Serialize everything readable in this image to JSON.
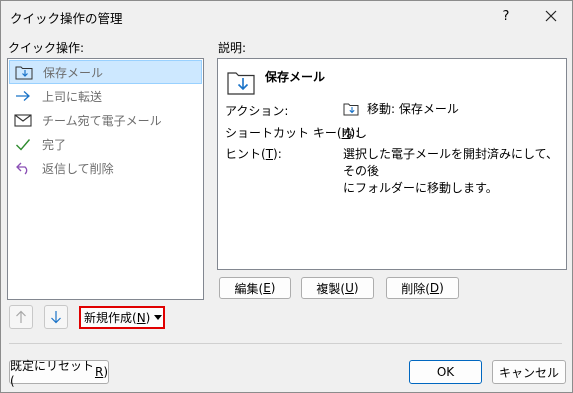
{
  "window": {
    "title": "クイック操作の管理",
    "help_glyph": "?"
  },
  "labels": {
    "quick_steps": "クイック操作:",
    "description": "説明:"
  },
  "quick_steps": [
    {
      "label": "保存メール",
      "icon": "folder-arrow-icon",
      "selected": true
    },
    {
      "label": "上司に転送",
      "icon": "right-arrow-icon",
      "selected": false
    },
    {
      "label": "チーム宛て電子メール",
      "icon": "envelope-icon",
      "selected": false
    },
    {
      "label": "完了",
      "icon": "checkmark-icon",
      "selected": false
    },
    {
      "label": "返信して削除",
      "icon": "reply-icon",
      "selected": false
    }
  ],
  "details": {
    "name": "保存メール",
    "action_label": "アクション:",
    "action_value": "移動: 保存メール",
    "shortcut_label": "ショートカット キー(",
    "shortcut_key": "H",
    "shortcut_suffix": "):",
    "shortcut_value": "なし",
    "hint_label": "ヒント(",
    "hint_key": "T",
    "hint_suffix": "):",
    "hint_value_line1": "選択した電子メールを開封済みにして、その後",
    "hint_value_line2": "にフォルダーに移動します。"
  },
  "buttons": {
    "edit": {
      "text": "編集(",
      "key": "E",
      "suffix": ")"
    },
    "duplicate": {
      "text": "複製(",
      "key": "U",
      "suffix": ")"
    },
    "delete": {
      "text": "削除(",
      "key": "D",
      "suffix": ")"
    },
    "new": {
      "text": "新規作成(",
      "key": "N",
      "suffix": ")"
    },
    "reset": {
      "text": "既定にリセット(",
      "key": "R",
      "suffix": ")"
    },
    "ok": "OK",
    "cancel": "キャンセル"
  },
  "colors": {
    "selection_bg": "#cde8ff",
    "accent": "#0067c0",
    "highlight_border": "#e00000",
    "icon_blue": "#1a73c8",
    "icon_green": "#2e8b2e",
    "icon_purple": "#8a4fb5"
  }
}
